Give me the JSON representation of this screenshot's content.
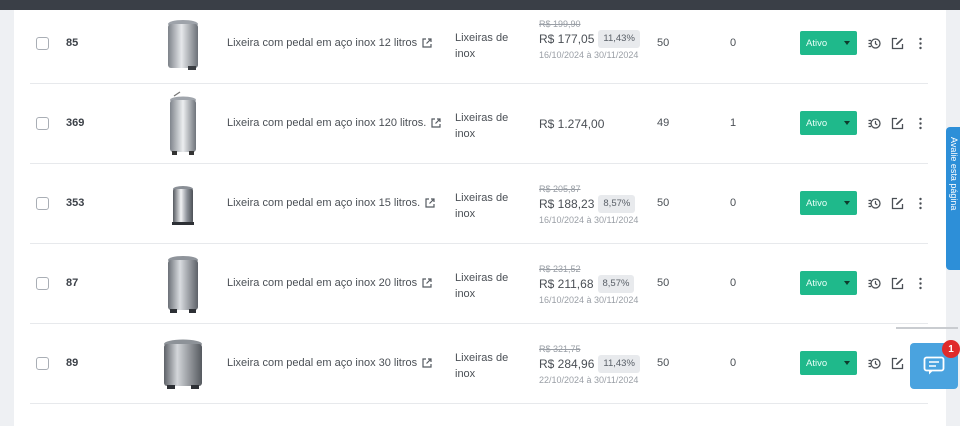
{
  "status_label": "Ativo",
  "side_tab_label": "Avalie esta página",
  "chat_badge_count": "1",
  "colors": {
    "status": "#1fb98b",
    "chat": "#4aa3df",
    "badge": "#e02b2b",
    "side_tab": "#2d8fd8"
  },
  "rows": [
    {
      "id": "85",
      "name": "Lixeira com pedal em aço inox 12 litros",
      "category": "Lixeiras de inox",
      "old_price": "R$ 199,90",
      "price": "R$ 177,05",
      "discount": "11,43%",
      "period": "16/10/2024 à 30/11/2024",
      "stock": "50",
      "sold": "0",
      "status": "Ativo"
    },
    {
      "id": "369",
      "name": "Lixeira com pedal em aço inox 120 litros.",
      "category": "Lixeiras de inox",
      "old_price": "",
      "price": "R$ 1.274,00",
      "discount": "",
      "period": "",
      "stock": "49",
      "sold": "1",
      "status": "Ativo"
    },
    {
      "id": "353",
      "name": "Lixeira com pedal em aço inox 15 litros.",
      "category": "Lixeiras de inox",
      "old_price": "R$ 205,87",
      "price": "R$ 188,23",
      "discount": "8,57%",
      "period": "16/10/2024 à 30/11/2024",
      "stock": "50",
      "sold": "0",
      "status": "Ativo"
    },
    {
      "id": "87",
      "name": "Lixeira com pedal em aço inox 20 litros",
      "category": "Lixeiras de inox",
      "old_price": "R$ 231,52",
      "price": "R$ 211,68",
      "discount": "8,57%",
      "period": "16/10/2024 à 30/11/2024",
      "stock": "50",
      "sold": "0",
      "status": "Ativo"
    },
    {
      "id": "89",
      "name": "Lixeira com pedal em aço inox 30 litros",
      "category": "Lixeiras de inox",
      "old_price": "R$ 321,75",
      "price": "R$ 284,96",
      "discount": "11,43%",
      "period": "22/10/2024 à 30/11/2024",
      "stock": "50",
      "sold": "0",
      "status": "Ativo"
    }
  ]
}
